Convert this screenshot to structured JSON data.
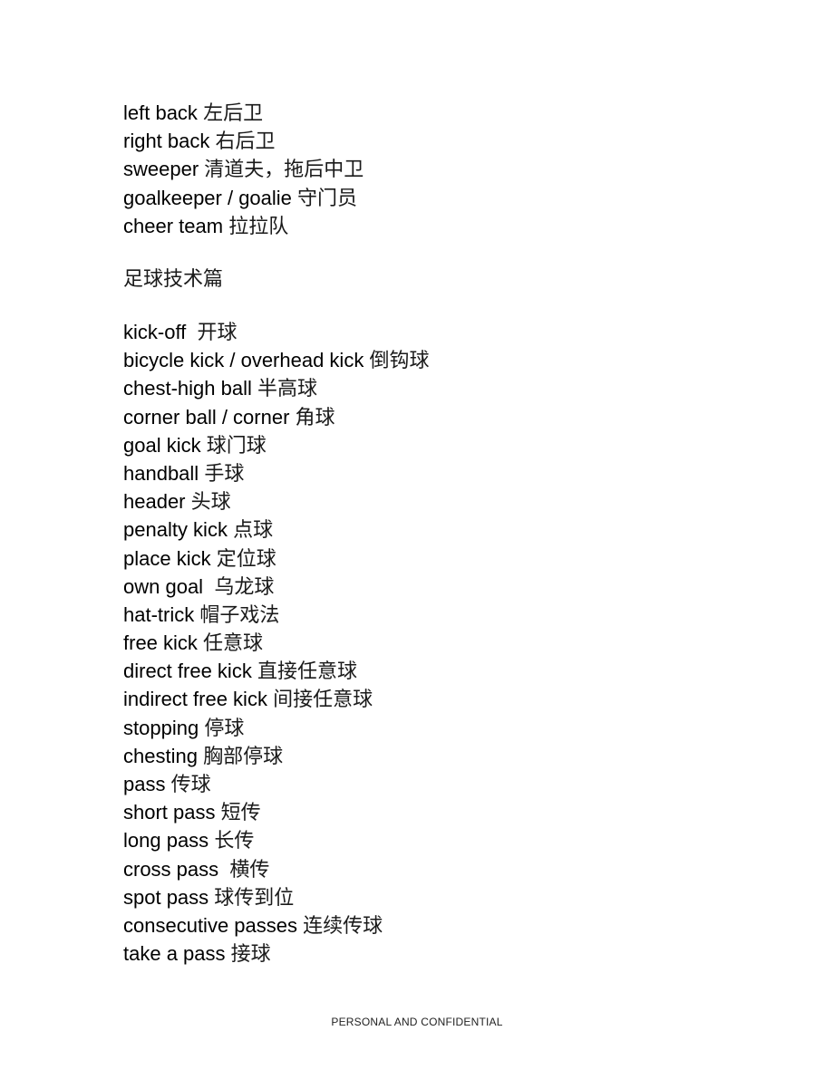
{
  "document": {
    "positions": [
      {
        "en": "left back",
        "zh": "左后卫"
      },
      {
        "en": "right back",
        "zh": "右后卫"
      },
      {
        "en": "sweeper",
        "zh": "清道夫，拖后中卫"
      },
      {
        "en": "goalkeeper / goalie",
        "zh": "守门员"
      },
      {
        "en": "cheer team",
        "zh": "拉拉队"
      }
    ],
    "section_heading": "足球技术篇",
    "techniques": [
      {
        "en": "kick-off ",
        "zh": "开球"
      },
      {
        "en": "bicycle kick / overhead kick",
        "zh": "倒钩球"
      },
      {
        "en": "chest-high ball",
        "zh": "半高球"
      },
      {
        "en": "corner ball / corner",
        "zh": "角球"
      },
      {
        "en": "goal kick",
        "zh": "球门球"
      },
      {
        "en": "handball",
        "zh": "手球"
      },
      {
        "en": "header",
        "zh": "头球"
      },
      {
        "en": "penalty kick",
        "zh": "点球"
      },
      {
        "en": "place kick",
        "zh": "定位球"
      },
      {
        "en": "own goal ",
        "zh": "乌龙球"
      },
      {
        "en": "hat-trick",
        "zh": "帽子戏法"
      },
      {
        "en": "free kick",
        "zh": "任意球"
      },
      {
        "en": "direct free kick",
        "zh": "直接任意球"
      },
      {
        "en": "indirect free kick",
        "zh": "间接任意球"
      },
      {
        "en": "stopping",
        "zh": "停球"
      },
      {
        "en": "chesting",
        "zh": "胸部停球"
      },
      {
        "en": "pass",
        "zh": "传球"
      },
      {
        "en": "short pass",
        "zh": "短传"
      },
      {
        "en": "long pass",
        "zh": "长传"
      },
      {
        "en": "cross pass ",
        "zh": "横传"
      },
      {
        "en": "spot pass",
        "zh": "球传到位"
      },
      {
        "en": "consecutive passes",
        "zh": "连续传球"
      },
      {
        "en": "take a pass",
        "zh": "接球"
      }
    ],
    "footer": "PERSONAL AND CONFIDENTIAL"
  }
}
